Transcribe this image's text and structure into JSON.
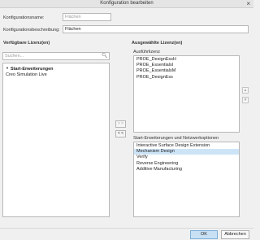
{
  "window": {
    "title": "Konfiguration bearbeiten",
    "close_glyph": "×"
  },
  "form": {
    "name_label": "Konfigurationsname:",
    "name_value": "Flächen",
    "description_label": "Konfigurationsbeschreibung:",
    "description_value": "Flächen"
  },
  "available": {
    "heading": "Verfügbare Lizenz(en)",
    "search_placeholder": "Suchen...",
    "search_icon": "search-icon",
    "group_label": "Start-Erweiterungen",
    "items": [
      "Creo Simulation Live"
    ]
  },
  "transfer": {
    "add_label": "> >",
    "remove_label": "< <"
  },
  "selected": {
    "heading": "Ausgewählte Lizenz(en)",
    "base_license_label": "Ausführlizenz",
    "base_licenses": [
      "PROE_DesignEssH",
      "PROE_EssentialsI",
      "PROE_EssentialsM",
      "PROE_DesignEss"
    ],
    "extensions_label": "Start-Erweiterungen und Netzwerkoptionen",
    "extensions": [
      {
        "label": "Interactive Surface Design Extension",
        "selected": false
      },
      {
        "label": "Mechanism Design",
        "selected": true
      },
      {
        "label": "Verify",
        "selected": false
      },
      {
        "label": "Reverse Engineering",
        "selected": false
      },
      {
        "label": "Additive Manufacturing",
        "selected": false
      }
    ],
    "up_icon": "arrow-up-icon",
    "down_icon": "arrow-down-icon"
  },
  "footer": {
    "ok_label": "OK",
    "cancel_label": "Abbrechen"
  },
  "colors": {
    "selected_row": "#cde4f7",
    "primary_button": "#c8e0f4"
  }
}
